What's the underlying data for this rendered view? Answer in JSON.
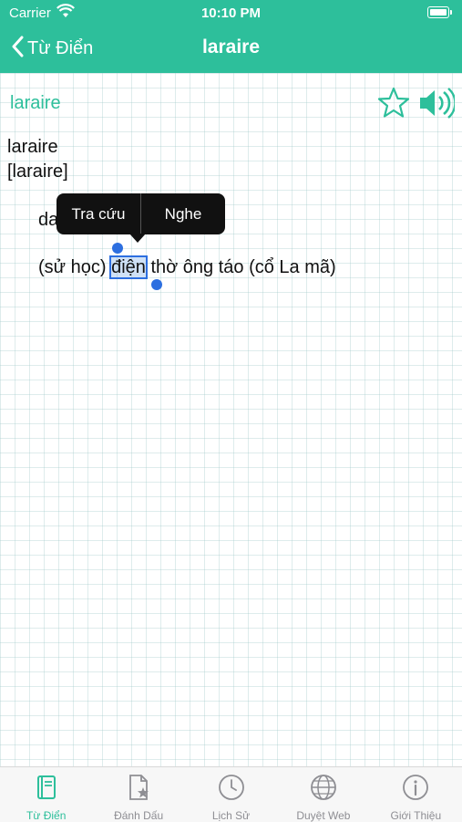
{
  "status_bar": {
    "carrier": "Carrier",
    "time": "10:10 PM"
  },
  "nav": {
    "back_label": "Từ Điển",
    "title": "laraire"
  },
  "entry": {
    "head_word": "laraire",
    "word": "laraire",
    "pronunciation": "[laraire]",
    "part_of_speech": "da",
    "definition_before": "(sử học) ",
    "definition_selected": "điện",
    "definition_after": " thờ ông táo (cổ La mã)"
  },
  "context_menu": {
    "lookup": "Tra cứu",
    "listen": "Nghe"
  },
  "tabs": [
    {
      "label": "Từ Điển",
      "icon": "book-icon",
      "active": true
    },
    {
      "label": "Đánh Dấu",
      "icon": "bookmark-icon",
      "active": false
    },
    {
      "label": "Lịch Sử",
      "icon": "clock-icon",
      "active": false
    },
    {
      "label": "Duyệt Web",
      "icon": "globe-icon",
      "active": false
    },
    {
      "label": "Giới Thiệu",
      "icon": "info-icon",
      "active": false
    }
  ],
  "colors": {
    "accent": "#2dbf9b",
    "selection": "#2d6fe0",
    "inactive": "#8e8e93"
  }
}
